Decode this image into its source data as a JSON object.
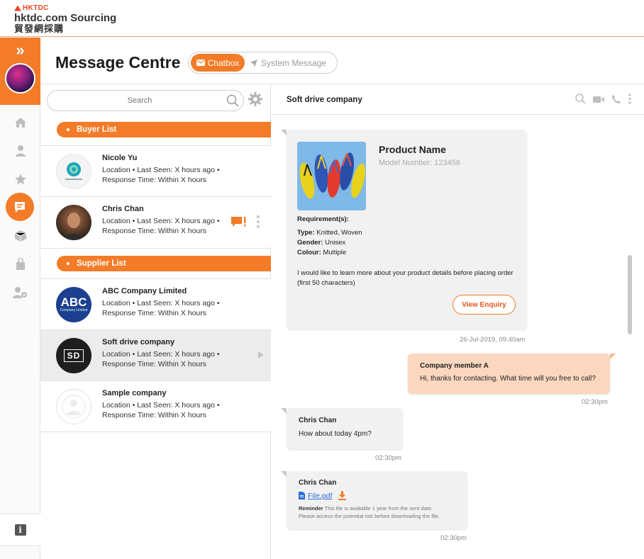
{
  "header": {
    "brand": "HKTDC",
    "site_name": "hktdc.com Sourcing",
    "site_name_cn": "貿發網採購"
  },
  "page": {
    "title": "Message Centre",
    "tabs": [
      {
        "label": "Chatbox",
        "active": true
      },
      {
        "label": "System Message",
        "active": false
      }
    ]
  },
  "sidebar": {
    "icons": [
      "expand-icon",
      "home-icon",
      "user-icon",
      "star-icon",
      "message-icon",
      "box-icon",
      "bag-icon",
      "user-settings-icon",
      "info-icon"
    ]
  },
  "search": {
    "placeholder": "Search"
  },
  "lists": {
    "buyer_label": "Buyer List",
    "supplier_label": "Supplier List",
    "buyers": [
      {
        "name": "Nicole Yu",
        "line1": "Location • Last Seen: X hours ago •",
        "line2": "Response Time: Within X hours",
        "badge": "!"
      },
      {
        "name": "Chris Chan",
        "line1": "Location • Last Seen: X hours ago •",
        "line2": "Response Time: Within X hours",
        "badge": "!"
      }
    ],
    "suppliers": [
      {
        "name": "ABC Company Limited",
        "line1": "Location • Last Seen: X hours ago •",
        "line2": "Response Time: Within X hours",
        "logo_text": "ABC",
        "logo_sub": "Company Limited"
      },
      {
        "name": "Soft drive company",
        "line1": "Location • Last Seen: X hours ago •",
        "line2": "Response Time: Within X hours",
        "logo_text": "SD"
      },
      {
        "name": "Sample company",
        "line1": "Location • Last Seen: X hours ago •",
        "line2": "Response Time: Within X hours"
      }
    ]
  },
  "chat": {
    "title": "Soft drive company",
    "enquiry": {
      "product_name": "Product Name",
      "model": "Model Number: 123456",
      "requirements_label": "Requirement(s):",
      "type_label": "Type:",
      "type_value": "Knitted, Woven",
      "gender_label": "Gender:",
      "gender_value": "Unisex",
      "colour_label": "Colour:",
      "colour_value": "Multiple",
      "message": "I would like to learn more about your product details before placing order (first 50 characters)",
      "button": "View Enquiry",
      "time": "26-Jul-2019, 09:40am"
    },
    "messages": [
      {
        "sender": "Company member A",
        "text": "Hi, thanks for contacting. What time will you free to call?",
        "time": "02:30pm"
      },
      {
        "sender": "Chris Chan",
        "text": "How about today 4pm?",
        "time": "02:30pm"
      },
      {
        "sender": "Chris Chan",
        "file": "File.pdf",
        "reminder_label": "Reminder",
        "reminder_text": "This file is available 1 year from the sent date.",
        "reminder_text2": "Please access the potential risk before downloading the file.",
        "time": "02:30pm"
      }
    ]
  },
  "colors": {
    "accent": "#f47b27",
    "out_bubble": "#fbd7bf",
    "in_bubble": "#f1f1f1",
    "link": "#2a6bd6"
  }
}
